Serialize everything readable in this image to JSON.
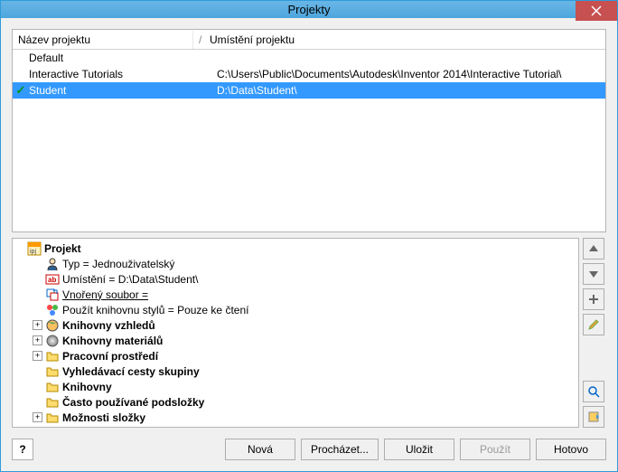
{
  "window": {
    "title": "Projekty"
  },
  "columns": {
    "name": "Název projektu",
    "sep": "/",
    "location": "Umístění projektu"
  },
  "projects": [
    {
      "checked": false,
      "name": "Default",
      "location": ""
    },
    {
      "checked": false,
      "name": "Interactive Tutorials",
      "location": "C:\\Users\\Public\\Documents\\Autodesk\\Inventor 2014\\Interactive Tutorial\\"
    },
    {
      "checked": true,
      "name": "Student",
      "location": "D:\\Data\\Student\\",
      "selected": true
    }
  ],
  "tree": {
    "root": "Projekt",
    "type_label": "Typ = Jednouživatelský",
    "location_label": "Umístění = D:\\Data\\Student\\",
    "nested_label": "Vnořený soubor =",
    "style_lib_label": "Použít knihovnu stylů = Pouze ke čtení",
    "appearance_libs": "Knihovny vzhledů",
    "material_libs": "Knihovny materiálů",
    "workspace": "Pracovní prostředí",
    "search_paths": "Vyhledávací cesty skupiny",
    "libraries": "Knihovny",
    "frequent_sub": "Často používané podsložky",
    "folder_opts": "Možnosti složky"
  },
  "side": {
    "up": "▲",
    "down": "▼",
    "add": "+",
    "edit": "edit",
    "find": "find",
    "config": "config"
  },
  "footer": {
    "help": "?",
    "new": "Nová",
    "browse": "Procházet...",
    "save": "Uložit",
    "apply": "Použít",
    "done": "Hotovo"
  }
}
